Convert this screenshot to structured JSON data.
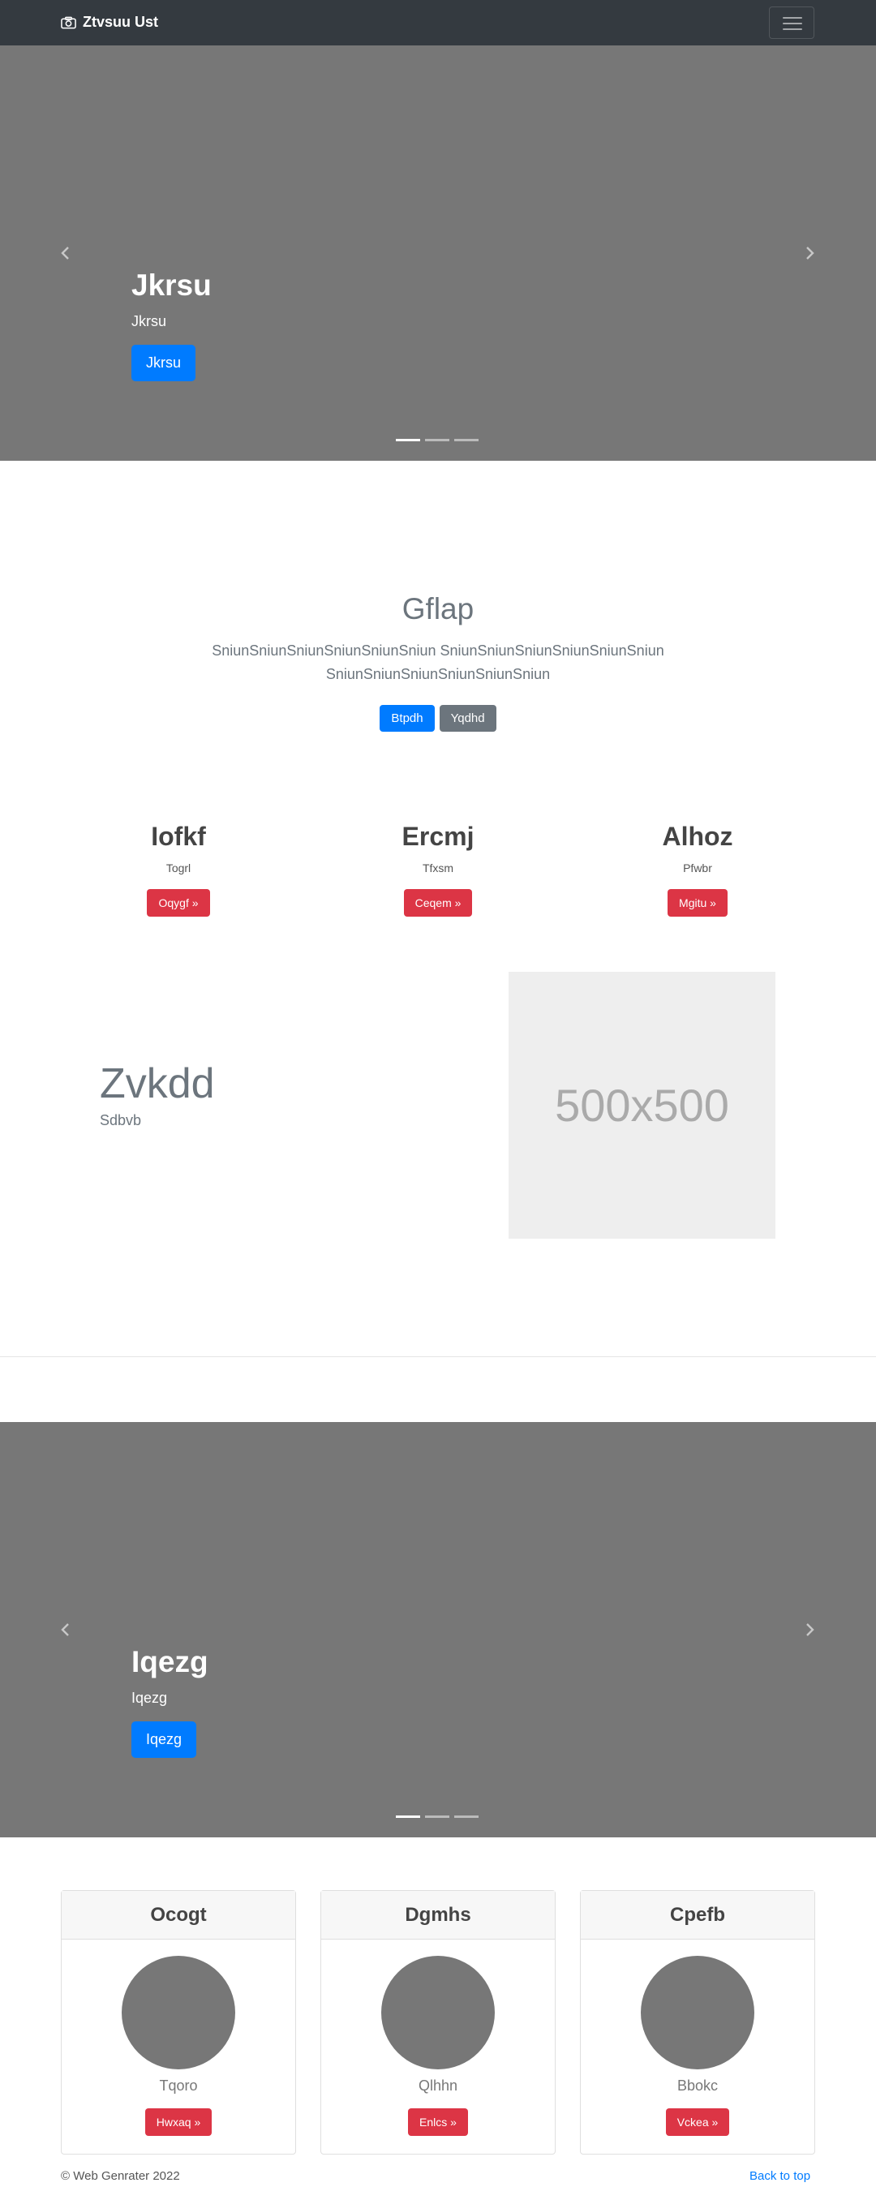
{
  "navbar": {
    "brand": "Ztvsuu Ust",
    "brand_icon": "camera-icon",
    "toggler_icon": "hamburger-menu-icon"
  },
  "carousel1": {
    "title": "Jkrsu",
    "text": "Jkrsu",
    "button": "Jkrsu",
    "prev_icon": "chevron-left-icon",
    "next_icon": "chevron-right-icon",
    "slides": 3,
    "active_slide": 1
  },
  "intro": {
    "title": "Gflap",
    "lead": "SniunSniunSniunSniunSniunSniun SniunSniunSniunSniunSniunSniun SniunSniunSniunSniunSniunSniun",
    "primary_button": "Btpdh",
    "secondary_button": "Yqdhd"
  },
  "columns": [
    {
      "title": "Iofkf",
      "text": "Togrl",
      "button": "Oqygf »"
    },
    {
      "title": "Ercmj",
      "text": "Tfxsm",
      "button": "Ceqem »"
    },
    {
      "title": "Alhoz",
      "text": "Pfwbr",
      "button": "Mgitu »"
    }
  ],
  "featurette": {
    "title": "Zvkdd",
    "text": "Sdbvb",
    "image_label": "500x500"
  },
  "carousel2": {
    "title": "Iqezg",
    "text": "Iqezg",
    "button": "Iqezg",
    "prev_icon": "chevron-left-icon",
    "next_icon": "chevron-right-icon",
    "slides": 3,
    "active_slide": 1
  },
  "cards": [
    {
      "header": "Ocogt",
      "text": "Tqoro",
      "button": "Hwxaq »"
    },
    {
      "header": "Dgmhs",
      "text": "Qlhhn",
      "button": "Enlcs »"
    },
    {
      "header": "Cpefb",
      "text": "Bbokc",
      "button": "Vckea »"
    }
  ],
  "footer": {
    "copyright": "© Web Genrater 2022",
    "back_to_top": "Back to top"
  },
  "colors": {
    "navbar_bg": "#343a40",
    "carousel_bg": "#777777",
    "primary": "#007bff",
    "secondary": "#6c757d",
    "danger": "#dc3545"
  }
}
